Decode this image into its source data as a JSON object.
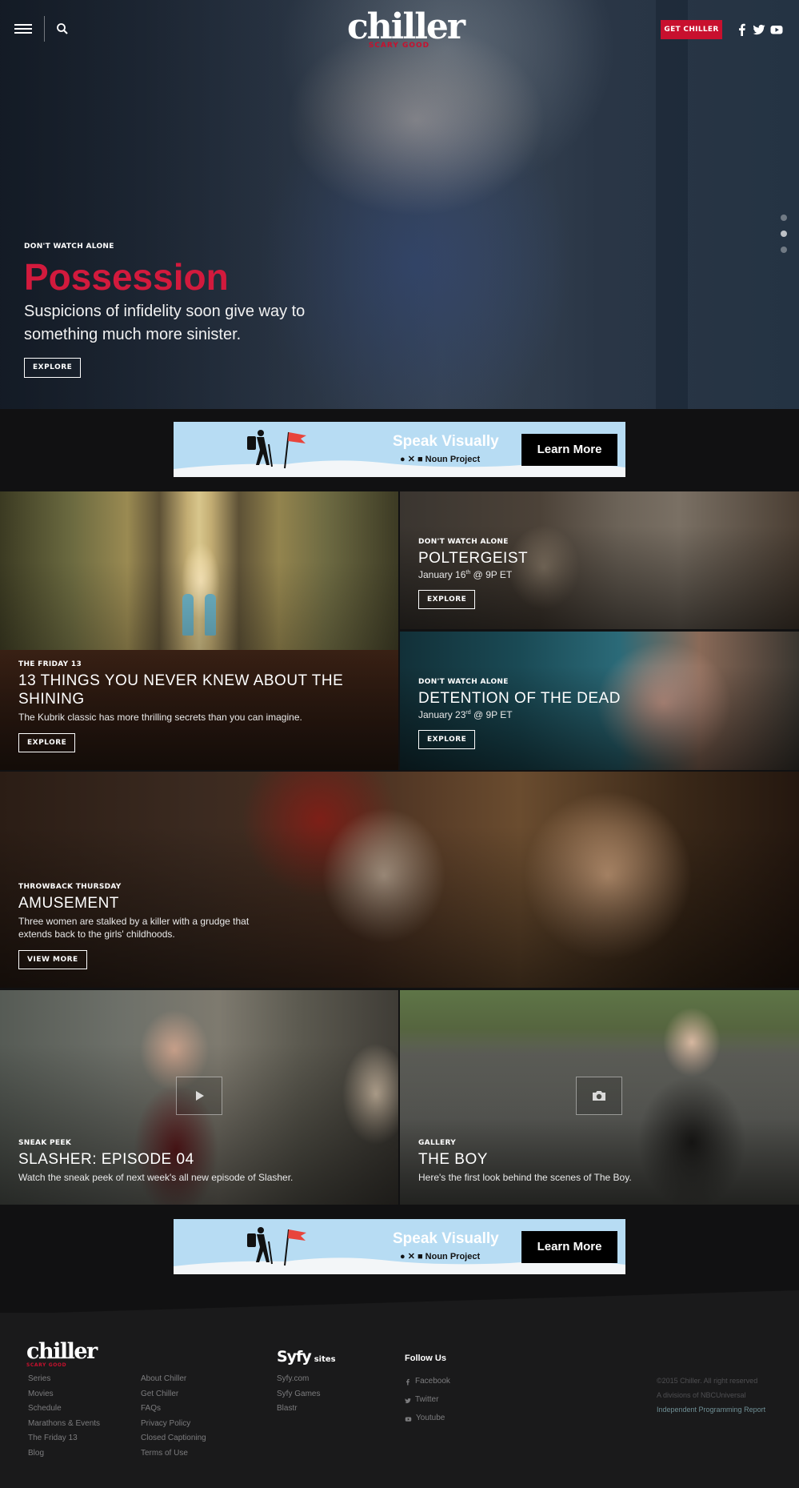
{
  "header": {
    "logo": "chiller",
    "logo_tag": "SCARY GOOD",
    "get_button": "GET CHILLER",
    "social_icons": [
      "facebook-icon",
      "twitter-icon",
      "youtube-icon"
    ]
  },
  "hero": {
    "kicker": "DON'T WATCH ALONE",
    "title": "Possession",
    "description_line1": "Suspicions of infidelity soon give way to",
    "description_line2": "something much more sinister.",
    "button": "EXPLORE",
    "slide_count": 3,
    "active_slide": 2
  },
  "ads": {
    "headline": "Speak Visually",
    "brand": "● ✕ ■  Noun Project",
    "cta": "Learn More"
  },
  "tiles": {
    "shining": {
      "kicker": "THE FRIDAY 13",
      "title_line1": "13 THINGS YOU NEVER KNEW ABOUT THE",
      "title_line2": "SHINING",
      "description": "The Kubrik classic has more thrilling secrets than you can imagine.",
      "button": "EXPLORE"
    },
    "poltergeist": {
      "kicker": "DON'T WATCH ALONE",
      "title": "POLTERGEIST",
      "date_prefix": "January 16",
      "date_sup": "th",
      "date_suffix": " @ 9P ET",
      "button": "EXPLORE"
    },
    "detention": {
      "kicker": "DON'T WATCH ALONE",
      "title": "DETENTION OF THE DEAD",
      "date_prefix": "January 23",
      "date_sup": "rd",
      "date_suffix": " @ 9P ET",
      "button": "EXPLORE"
    },
    "amusement": {
      "kicker": "THROWBACK THURSDAY",
      "title": "AMUSEMENT",
      "description_line1": "Three women are stalked by a killer with a grudge that",
      "description_line2": "extends back to the girls' childhoods.",
      "button": "VIEW MORE"
    },
    "slasher": {
      "kicker": "SNEAK PEEK",
      "title": "SLASHER: EPISODE 04",
      "description": "Watch the sneak peek of next week's all new episode of Slasher."
    },
    "boy": {
      "kicker": "GALLERY",
      "title": "THE BOY",
      "description": "Here's the first look behind the scenes of The Boy."
    }
  },
  "footer": {
    "logo": "chiller",
    "logo_tag": "SCARY GOOD",
    "col1": [
      "Series",
      "Movies",
      "Schedule",
      "Marathons & Events",
      "The Friday 13",
      "Blog"
    ],
    "col2": [
      "About Chiller",
      "Get Chiller",
      "FAQs",
      "Privacy Policy",
      "Closed Captioning",
      "Terms of Use"
    ],
    "syfy_logo": "Syfy",
    "syfy_sites_label": "sites",
    "col3": [
      "Syfy.com",
      "Syfy Games",
      "Blastr"
    ],
    "follow_title": "Follow Us",
    "follow": [
      "Facebook",
      "Twitter",
      "Youtube"
    ],
    "copyright": "©2015 Chiller. All right reserved",
    "division": "A divisions of NBCUniversal",
    "report_link": "Independent Programming Report"
  }
}
